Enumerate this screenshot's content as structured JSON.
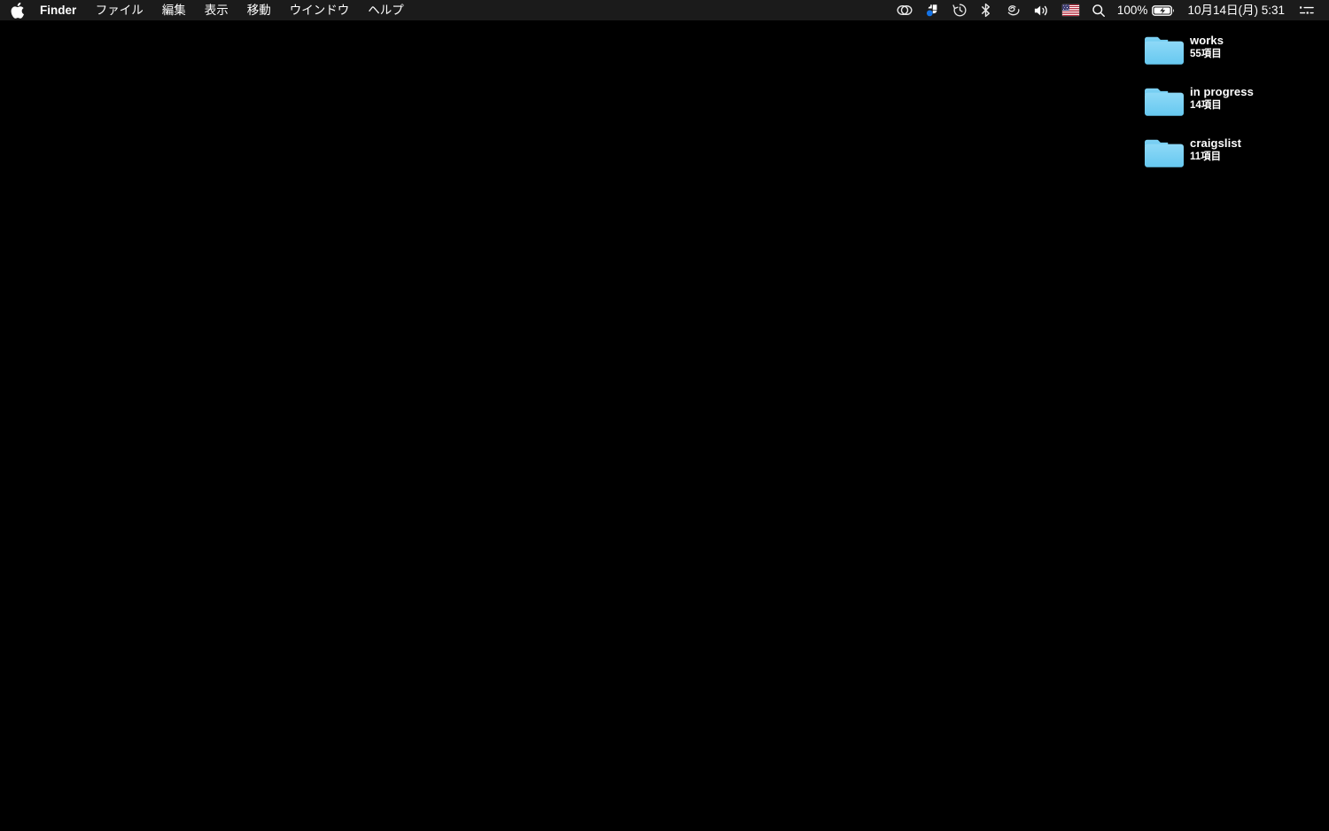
{
  "menubar": {
    "apple_icon": "apple-logo-icon",
    "app_name": "Finder",
    "items": [
      {
        "label": "ファイル",
        "name": "menu-file"
      },
      {
        "label": "編集",
        "name": "menu-edit"
      },
      {
        "label": "表示",
        "name": "menu-view"
      },
      {
        "label": "移動",
        "name": "menu-go"
      },
      {
        "label": "ウインドウ",
        "name": "menu-window"
      },
      {
        "label": "ヘルプ",
        "name": "menu-help"
      }
    ],
    "status": {
      "creative_cloud_icon": "adobe-creative-cloud-icon",
      "sync_icon": "sync-status-icon",
      "time_machine_icon": "time-machine-icon",
      "bluetooth_icon": "bluetooth-icon",
      "cloud_spiral_icon": "cloud-spiral-icon",
      "volume_icon": "volume-icon",
      "input_source_icon": "us-flag-icon",
      "spotlight_icon": "search-icon",
      "battery_percent": "100%",
      "battery_icon": "battery-charging-icon",
      "datetime": "10月14日(月) 5:31",
      "control_center_icon": "control-center-icon"
    }
  },
  "desktop": {
    "background_color": "#000000",
    "folder_color": "#76cef2",
    "folders": [
      {
        "name": "works",
        "count": "55項目"
      },
      {
        "name": "in progress",
        "count": "14項目"
      },
      {
        "name": "craigslist",
        "count": "11項目"
      }
    ]
  }
}
